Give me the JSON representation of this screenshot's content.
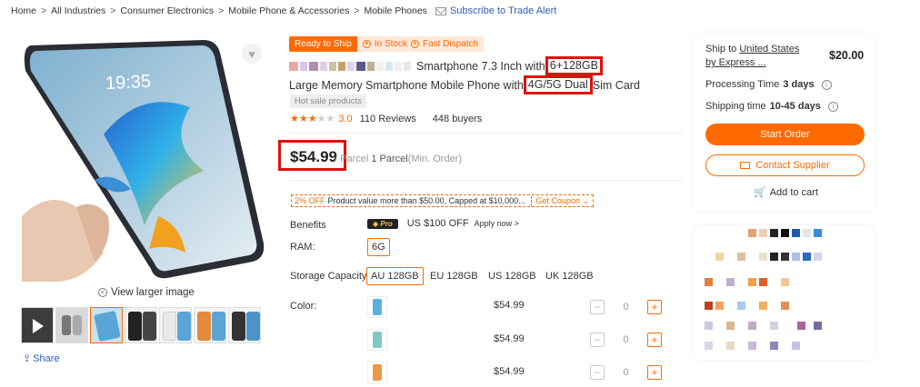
{
  "breadcrumb": {
    "items": [
      "Home",
      "All Industries",
      "Consumer Electronics",
      "Mobile Phone & Accessories",
      "Mobile Phones"
    ],
    "separator": ">",
    "subscribe_label": "Subscribe to Trade Alert"
  },
  "gallery": {
    "phone_time": "19:35",
    "view_larger": "View larger image",
    "share": "Share",
    "thumbnail_count": 8
  },
  "product": {
    "badge_ship": "Ready to Ship",
    "badge_stock": "In Stock",
    "badge_dispatch": "Fast Dispatch",
    "title_part1": "Smartphone 7.3 Inch with",
    "title_highlight1": "6+128GB",
    "title_part2": "Large Memory Smartphone Mobile Phone with",
    "title_highlight2": "4G/5G Dual",
    "title_part3": "Sim Card",
    "hot_tag": "Hot sale products",
    "rating": "3.0",
    "reviews": "110 Reviews",
    "buyers": "448 buyers",
    "price": "$54.99",
    "price_unit": "/ Parcel",
    "moq": "1 Parcel",
    "moq_note": "(Min. Order)"
  },
  "coupon": {
    "off": "2% OFF",
    "text": "Product value more than $50.00, Capped at $10,000...",
    "get": "Get Coupon"
  },
  "attributes": {
    "benefits_label": "Benefits",
    "pro_label": "Pro",
    "benefit_offer": "US $100 OFF",
    "apply_now": "Apply now >",
    "ram_label": "RAM:",
    "ram_options": [
      "6G"
    ],
    "storage_label": "Storage Capacity:",
    "storage_options": [
      "AU 128GB",
      "EU 128GB",
      "US 128GB",
      "UK 128GB"
    ],
    "color_label": "Color:",
    "colors": [
      {
        "price": "$54.99",
        "qty": "0",
        "swatch": "#5ab0e0"
      },
      {
        "price": "$54.99",
        "qty": "0",
        "swatch": "#7fc9c9"
      },
      {
        "price": "$54.99",
        "qty": "0",
        "swatch": "#e89a4a"
      }
    ]
  },
  "order_panel": {
    "ship_to_prefix": "Ship to",
    "ship_to_country": "United States",
    "ship_by": "by Express ...",
    "shipping_price": "$20.00",
    "processing_label": "Processing Time",
    "processing_value": "3 days",
    "shipping_label": "Shipping time",
    "shipping_value": "10-45 days",
    "start_order": "Start Order",
    "contact_supplier": "Contact Supplier",
    "add_to_cart": "Add to cart"
  },
  "colors": {
    "accent": "#ff6a00",
    "highlight_box": "#e01010",
    "link": "#2d5fb8"
  }
}
